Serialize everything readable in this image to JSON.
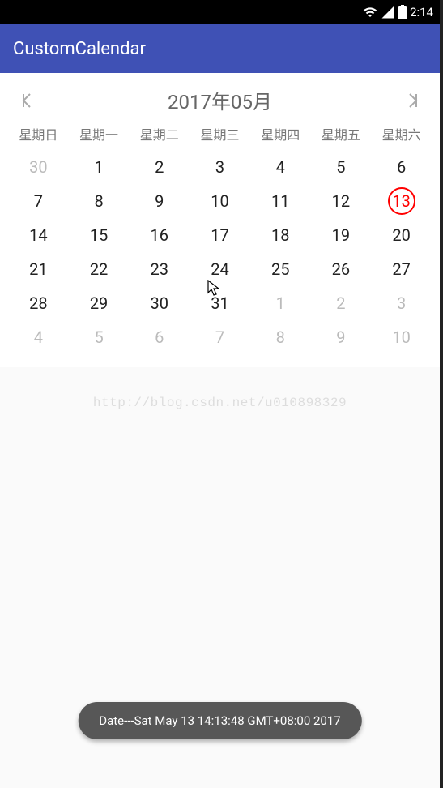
{
  "status": {
    "time": "2:14"
  },
  "app": {
    "title": "CustomCalendar"
  },
  "calendar": {
    "month_title": "2017年05月",
    "weekdays": [
      "星期日",
      "星期一",
      "星期二",
      "星期三",
      "星期四",
      "星期五",
      "星期六"
    ],
    "selected_day": 13,
    "cells": [
      {
        "n": 30,
        "out": true
      },
      {
        "n": 1
      },
      {
        "n": 2
      },
      {
        "n": 3
      },
      {
        "n": 4
      },
      {
        "n": 5
      },
      {
        "n": 6
      },
      {
        "n": 7
      },
      {
        "n": 8
      },
      {
        "n": 9
      },
      {
        "n": 10
      },
      {
        "n": 11
      },
      {
        "n": 12
      },
      {
        "n": 13,
        "selected": true
      },
      {
        "n": 14
      },
      {
        "n": 15
      },
      {
        "n": 16
      },
      {
        "n": 17
      },
      {
        "n": 18
      },
      {
        "n": 19
      },
      {
        "n": 20
      },
      {
        "n": 21
      },
      {
        "n": 22
      },
      {
        "n": 23
      },
      {
        "n": 24
      },
      {
        "n": 25
      },
      {
        "n": 26
      },
      {
        "n": 27
      },
      {
        "n": 28
      },
      {
        "n": 29
      },
      {
        "n": 30
      },
      {
        "n": 31
      },
      {
        "n": 1,
        "out": true
      },
      {
        "n": 2,
        "out": true
      },
      {
        "n": 3,
        "out": true
      },
      {
        "n": 4,
        "out": true
      },
      {
        "n": 5,
        "out": true
      },
      {
        "n": 6,
        "out": true
      },
      {
        "n": 7,
        "out": true
      },
      {
        "n": 8,
        "out": true
      },
      {
        "n": 9,
        "out": true
      },
      {
        "n": 10,
        "out": true
      }
    ]
  },
  "watermark": "http://blog.csdn.net/u010898329",
  "toast": {
    "text": "Date---Sat May 13 14:13:48 GMT+08:00 2017"
  }
}
